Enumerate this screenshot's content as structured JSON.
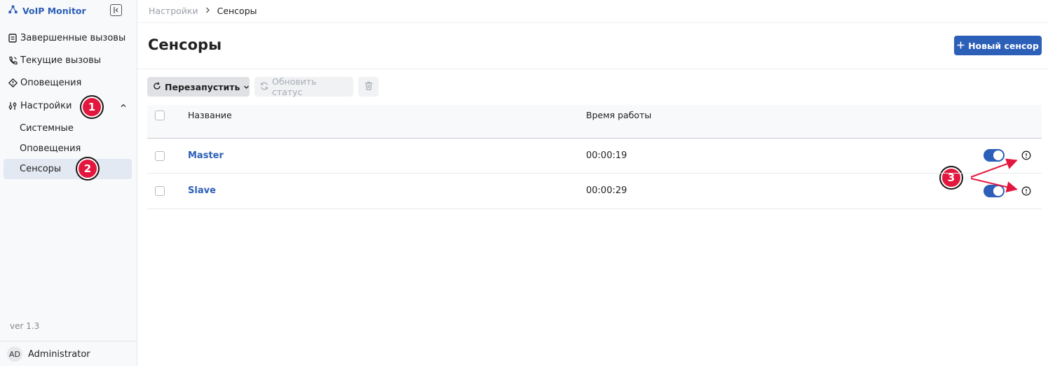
{
  "app": {
    "name": "VoIP Monitor",
    "version": "ver 1.3"
  },
  "sidebar": {
    "items": [
      {
        "label": "Завершенные вызовы",
        "icon": "report-icon"
      },
      {
        "label": "Текущие вызовы",
        "icon": "phone-call-icon"
      },
      {
        "label": "Оповещения",
        "icon": "alert-icon"
      },
      {
        "label": "Настройки",
        "icon": "sliders-icon",
        "expanded": true
      }
    ],
    "sub_items": [
      {
        "label": "Системные"
      },
      {
        "label": "Оповещения"
      },
      {
        "label": "Сенсоры",
        "active": true
      }
    ],
    "user": {
      "initials": "AD",
      "name": "Administrator"
    }
  },
  "breadcrumb": {
    "parent": "Настройки",
    "current": "Сенсоры"
  },
  "page": {
    "title": "Сенсоры",
    "new_button": "Новый сенсор"
  },
  "toolbar": {
    "restart": "Перезапустить",
    "refresh_status": "Обновить статус"
  },
  "table": {
    "columns": [
      "Название",
      "Время работы"
    ],
    "rows": [
      {
        "name": "Master",
        "uptime": "00:00:19",
        "enabled": true
      },
      {
        "name": "Slave",
        "uptime": "00:00:29",
        "enabled": true
      }
    ]
  },
  "annotations": [
    "1",
    "2",
    "3"
  ],
  "colors": {
    "accent": "#2c5fb8",
    "annotation": "#e3173e",
    "sidebar_active": "#e3e9f3"
  }
}
